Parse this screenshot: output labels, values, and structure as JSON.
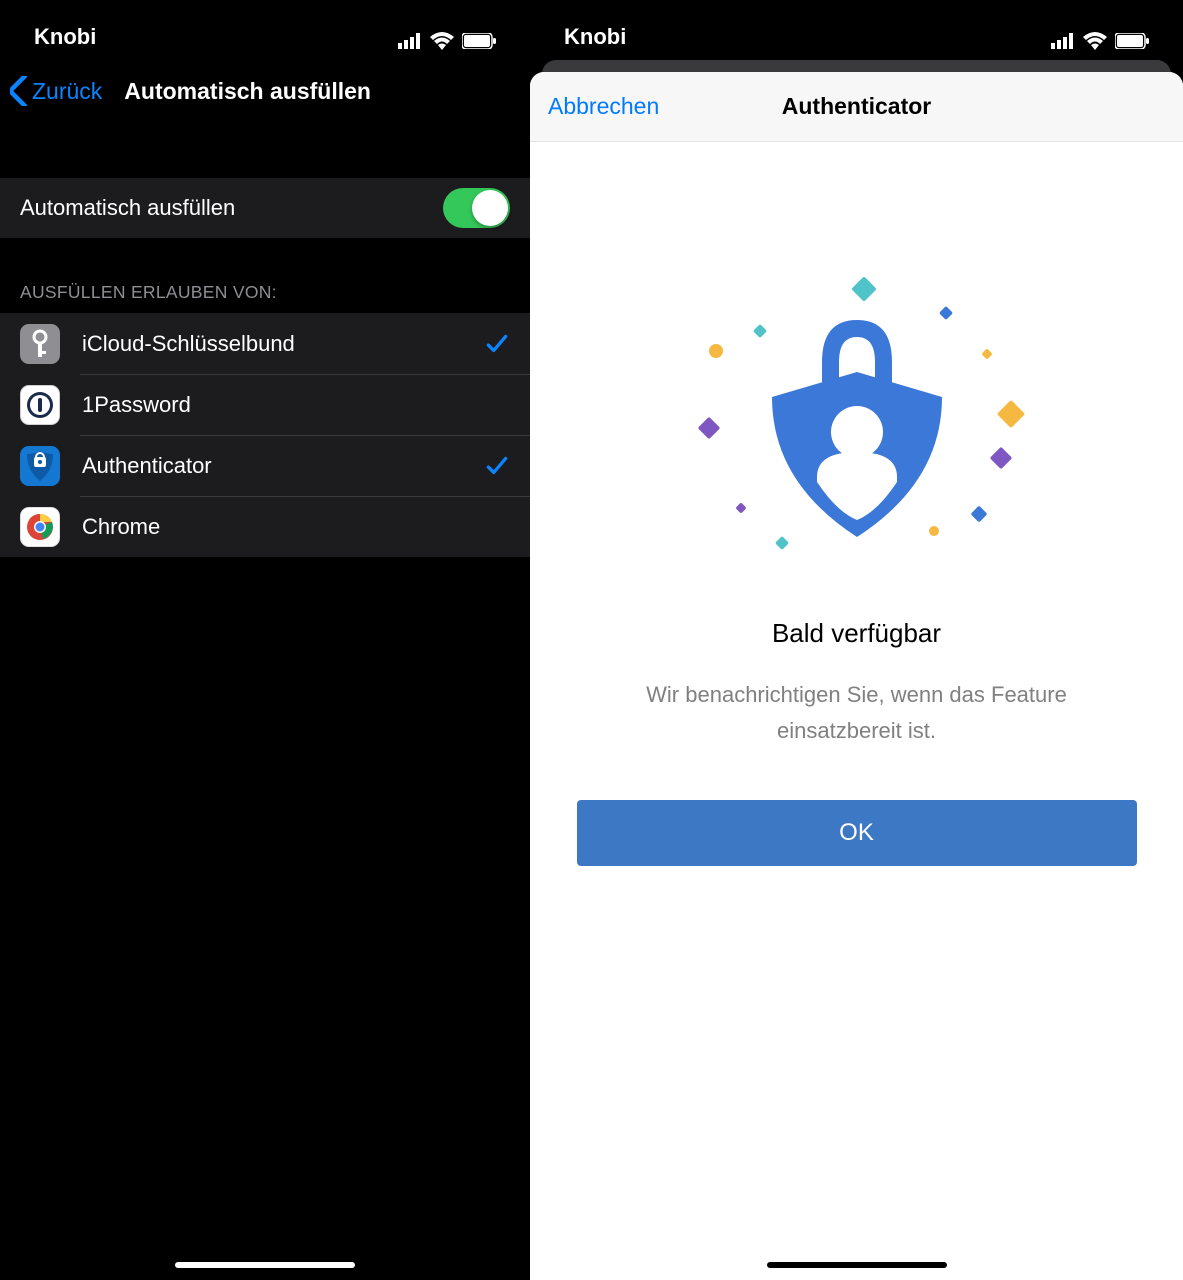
{
  "left": {
    "status": {
      "carrier": "Knobi"
    },
    "nav": {
      "back": "Zurück",
      "title": "Automatisch ausfüllen"
    },
    "toggle": {
      "label": "Automatisch ausfüllen"
    },
    "group_header": "AUSFÜLLEN ERLAUBEN VON:",
    "items": [
      {
        "label": "iCloud-Schlüsselbund",
        "checked": true,
        "icon": "key"
      },
      {
        "label": "1Password",
        "checked": false,
        "icon": "1p"
      },
      {
        "label": "Authenticator",
        "checked": true,
        "icon": "auth"
      },
      {
        "label": "Chrome",
        "checked": false,
        "icon": "chrome"
      }
    ]
  },
  "right": {
    "status": {
      "carrier": "Knobi"
    },
    "sheet": {
      "cancel": "Abbrechen",
      "title": "Authenticator",
      "heading": "Bald verfügbar",
      "body": "Wir benachrichtigen Sie, wenn das Feature einsatzbereit ist.",
      "ok": "OK"
    }
  }
}
